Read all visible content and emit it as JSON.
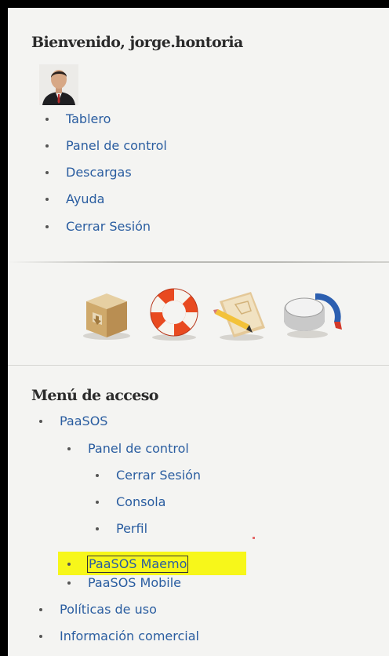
{
  "welcome": {
    "title": "Bienvenido, jorge.hontoria"
  },
  "user_menu": [
    {
      "label": "Tablero"
    },
    {
      "label": "Panel de control"
    },
    {
      "label": "Descargas"
    },
    {
      "label": "Ayuda"
    },
    {
      "label": "Cerrar Sesión"
    }
  ],
  "quick_icons": [
    {
      "name": "download-box-icon"
    },
    {
      "name": "lifebuoy-icon"
    },
    {
      "name": "notepad-pencil-icon"
    },
    {
      "name": "gauge-knob-icon"
    }
  ],
  "access_menu": {
    "title": "Menú de acceso",
    "items": {
      "paasos": "PaaSOS",
      "panel": "Panel de control",
      "cerrar": "Cerrar Sesión",
      "consola": "Consola",
      "perfil": "Perfil",
      "maemo": "PaaSOS Maemo",
      "mobile": "PaaSOS Mobile",
      "politicas": "Políticas de uso",
      "comercial": "Información comercial"
    }
  },
  "colors": {
    "link": "#2a5da0",
    "highlight": "#f7f71a",
    "panel_bg": "#f4f4f2"
  }
}
